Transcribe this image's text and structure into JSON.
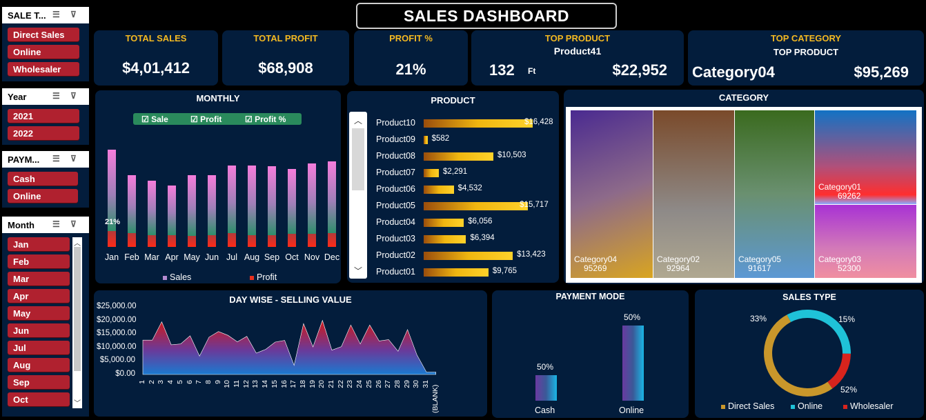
{
  "title": "SALES DASHBOARD",
  "slicers": {
    "sale_type": {
      "title": "SALE T...",
      "items": [
        "Direct Sales",
        "Online",
        "Wholesaler"
      ]
    },
    "year": {
      "title": "Year",
      "items": [
        "2021",
        "2022"
      ]
    },
    "payment": {
      "title": "PAYM...",
      "items": [
        "Cash",
        "Online"
      ]
    },
    "month": {
      "title": "Month",
      "items": [
        "Jan",
        "Feb",
        "Mar",
        "Apr",
        "May",
        "Jun",
        "Jul",
        "Aug",
        "Sep",
        "Oct"
      ]
    }
  },
  "kpis": {
    "total_sales": {
      "label": "TOTAL SALES",
      "value": "$4,01,412"
    },
    "total_profit": {
      "label": "TOTAL PROFIT",
      "value": "$68,908"
    },
    "profit_pct": {
      "label": "PROFIT %",
      "value": "21%"
    },
    "top_product": {
      "label": "TOP PRODUCT",
      "name": "Product41",
      "qty": "132",
      "unit": "Ft",
      "value": "$22,952"
    },
    "top_category": {
      "label": "TOP CATEGORY",
      "sub": "TOP PRODUCT",
      "name": "Category04",
      "value": "$95,269"
    }
  },
  "monthly": {
    "title": "MONTHLY",
    "checks": [
      "Sale",
      "Profit",
      "Profit %"
    ],
    "annotation": "21%",
    "legend": [
      "Sales",
      "Profit"
    ],
    "colors": {
      "sale_top": "#f57ddb",
      "sale_bottom": "#2e8f6c",
      "profit": "#e8301e"
    }
  },
  "product": {
    "title": "PRODUCT"
  },
  "category": {
    "title": "CATEGORY"
  },
  "daywise": {
    "title": "DAY WISE - SELLING VALUE"
  },
  "payment_mode": {
    "title": "PAYMENT MODE"
  },
  "sales_type": {
    "title": "SALES TYPE",
    "legend": [
      "Direct Sales",
      "Online",
      "Wholesaler"
    ]
  },
  "chart_data": [
    {
      "type": "bar",
      "title": "MONTHLY",
      "categories": [
        "Jan",
        "Feb",
        "Mar",
        "Apr",
        "May",
        "Jun",
        "Jul",
        "Aug",
        "Sep",
        "Oct",
        "Nov",
        "Dec"
      ],
      "series": [
        {
          "name": "Sales",
          "values": [
            100,
            74,
            68,
            63,
            74,
            74,
            84,
            84,
            83,
            80,
            86,
            88
          ]
        },
        {
          "name": "Profit",
          "values": [
            16,
            14,
            12,
            12,
            11,
            12,
            14,
            12,
            12,
            13,
            13,
            14
          ]
        }
      ]
    },
    {
      "type": "bar",
      "title": "PRODUCT",
      "categories": [
        "Product10",
        "Product09",
        "Product08",
        "Product07",
        "Product06",
        "Product05",
        "Product04",
        "Product03",
        "Product02",
        "Product01"
      ],
      "values": [
        16428,
        582,
        10503,
        2291,
        4532,
        15717,
        6056,
        6394,
        13423,
        9765
      ],
      "labels": [
        "$16,428",
        "$582",
        "$10,503",
        "$2,291",
        "$4,532",
        "$15,717",
        "$6,056",
        "$6,394",
        "$13,423",
        "$9,765"
      ]
    },
    {
      "type": "heatmap",
      "title": "CATEGORY",
      "categories": [
        "Category04",
        "Category02",
        "Category05",
        "Category01",
        "Category03"
      ],
      "values": [
        95269,
        92964,
        91617,
        69262,
        52300
      ]
    },
    {
      "type": "area",
      "title": "DAY WISE - SELLING VALUE",
      "x": [
        "1",
        "2",
        "3",
        "4",
        "5",
        "6",
        "7",
        "8",
        "9",
        "10",
        "11",
        "12",
        "13",
        "14",
        "15",
        "16",
        "17",
        "18",
        "19",
        "20",
        "21",
        "22",
        "23",
        "24",
        "25",
        "26",
        "27",
        "28",
        "29",
        "30",
        "31",
        "(BLANK)"
      ],
      "y_ticks": [
        "$25,000.00",
        "$20,000.00",
        "$15,000.00",
        "$10,000.00",
        "$5,000.00",
        "$0.00"
      ],
      "ylim": [
        0,
        25000
      ],
      "values": [
        12700,
        12700,
        19500,
        11000,
        11300,
        14300,
        6800,
        13800,
        15900,
        14500,
        12100,
        14100,
        7900,
        9300,
        12000,
        12600,
        3400,
        18800,
        10200,
        20000,
        9000,
        10300,
        18300,
        11300,
        18300,
        12400,
        12900,
        8600,
        16600,
        7200,
        900,
        900
      ]
    },
    {
      "type": "bar",
      "title": "PAYMENT MODE",
      "categories": [
        "Cash",
        "Online"
      ],
      "values": [
        50,
        50
      ],
      "labels": [
        "50%",
        "50%"
      ]
    },
    {
      "type": "pie",
      "title": "SALES TYPE",
      "categories": [
        "Direct Sales",
        "Online",
        "Wholesaler"
      ],
      "values": [
        52,
        33,
        15
      ],
      "labels": [
        "52%",
        "33%",
        "15%"
      ],
      "colors": [
        "#c9972b",
        "#1fc2d8",
        "#d8241d"
      ]
    }
  ]
}
